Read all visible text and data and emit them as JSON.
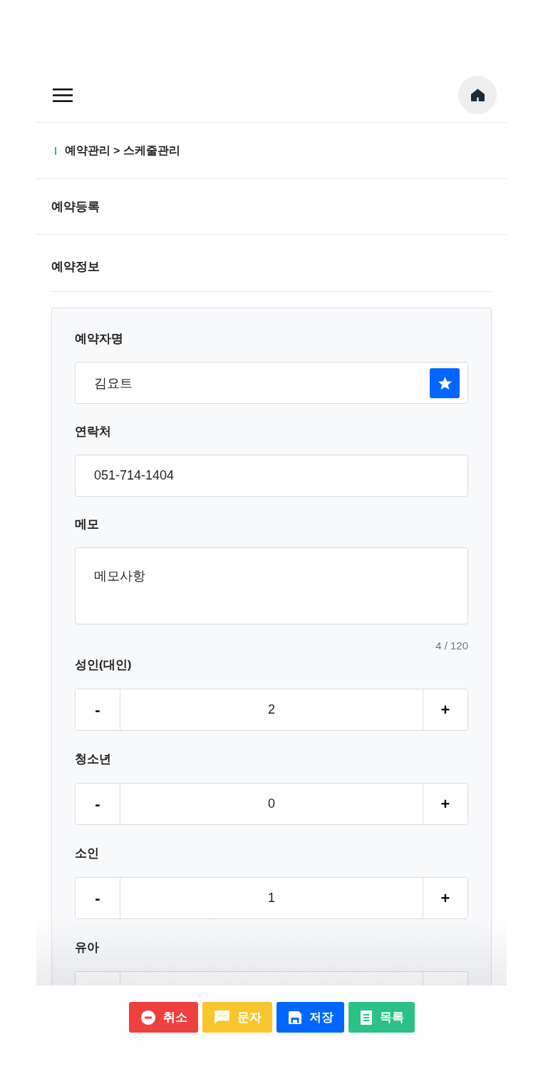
{
  "breadcrumb": "예약관리 > 스케줄관리",
  "page_title": "예약등록",
  "section_title": "예약정보",
  "fields": [
    {
      "kind": "lookup",
      "label": "예약자명",
      "value": "김요트"
    },
    {
      "kind": "input",
      "label": "연락처",
      "value": "051-714-1404"
    },
    {
      "kind": "textarea",
      "label": "메모",
      "value": "메모사항",
      "counter": "4 / 120"
    },
    {
      "kind": "stepper",
      "label": "성인(대인)",
      "minus": "-",
      "value": "2",
      "plus": "+"
    },
    {
      "kind": "stepper",
      "label": "청소년",
      "minus": "-",
      "value": "0",
      "plus": "+"
    },
    {
      "kind": "stepper",
      "label": "소인",
      "minus": "-",
      "value": "1",
      "plus": "+"
    },
    {
      "kind": "stepper",
      "label": "유아"
    }
  ],
  "actions": [
    {
      "kind": "cancel",
      "label": "취소",
      "color": "#ef4040"
    },
    {
      "kind": "message",
      "label": "문자",
      "color": "#f8c52c"
    },
    {
      "kind": "save",
      "label": "저장",
      "color": "#0066ff"
    },
    {
      "kind": "list",
      "label": "목록",
      "color": "#2bc187"
    }
  ]
}
